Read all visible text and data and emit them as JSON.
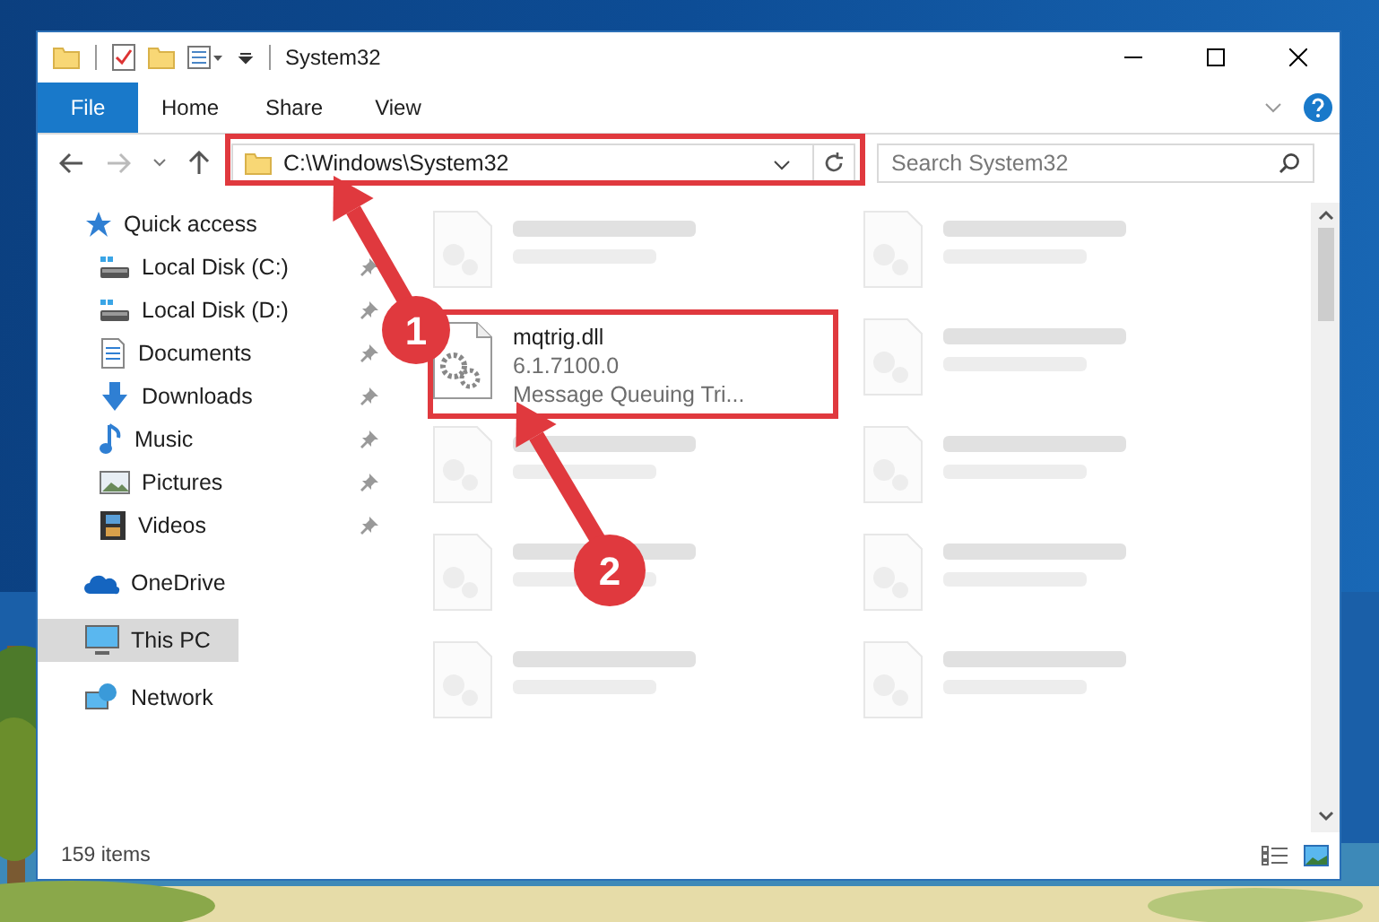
{
  "window": {
    "title": "System32"
  },
  "ribbon_tabs": [
    {
      "label": "File",
      "kind": "file"
    },
    {
      "label": "Home",
      "kind": "tab"
    },
    {
      "label": "Share",
      "kind": "tab"
    },
    {
      "label": "View",
      "kind": "tab"
    }
  ],
  "address_bar": {
    "path": "C:\\Windows\\System32"
  },
  "search": {
    "placeholder": "Search System32"
  },
  "sidebar": {
    "items": [
      {
        "label": "Quick access",
        "kind": "star",
        "pinned": false,
        "selected": false,
        "children": [
          {
            "label": "Local Disk (C:)",
            "kind": "disk",
            "pinned": true,
            "selected": false
          },
          {
            "label": "Local Disk (D:)",
            "kind": "disk",
            "pinned": true,
            "selected": false
          },
          {
            "label": "Documents",
            "kind": "documents",
            "pinned": true,
            "selected": false
          },
          {
            "label": "Downloads",
            "kind": "downloads",
            "pinned": true,
            "selected": false
          },
          {
            "label": "Music",
            "kind": "music",
            "pinned": true,
            "selected": false
          },
          {
            "label": "Pictures",
            "kind": "pictures",
            "pinned": true,
            "selected": false
          },
          {
            "label": "Videos",
            "kind": "videos",
            "pinned": true,
            "selected": false
          }
        ]
      },
      {
        "label": "OneDrive",
        "kind": "cloud",
        "pinned": false,
        "selected": false
      },
      {
        "label": "This PC",
        "kind": "computer",
        "pinned": false,
        "selected": true
      },
      {
        "label": "Network",
        "kind": "network",
        "pinned": false,
        "selected": false
      }
    ]
  },
  "files": [
    {
      "kind": "blurred"
    },
    {
      "kind": "blurred"
    },
    {
      "name": "mqtrig.dll",
      "version": "6.1.7100.0",
      "description": "Message Queuing Tri...",
      "kind": "focus"
    },
    {
      "kind": "blurred"
    },
    {
      "kind": "blurred"
    },
    {
      "kind": "blurred"
    },
    {
      "kind": "blurred"
    },
    {
      "kind": "blurred"
    },
    {
      "kind": "blurred"
    },
    {
      "kind": "blurred"
    }
  ],
  "status_bar": {
    "item_count": "159 items"
  },
  "annotations": [
    {
      "label": "1"
    },
    {
      "label": "2"
    }
  ]
}
